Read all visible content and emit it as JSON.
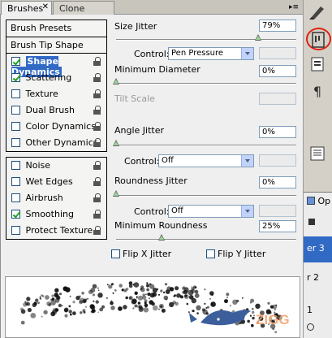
{
  "tabs": [
    {
      "label": "Brushes",
      "close": "✕"
    },
    {
      "label": "Clone Source"
    }
  ],
  "menu_icon": "▸≡",
  "options": {
    "presets": "Brush Presets",
    "tip_shape": "Brush Tip Shape",
    "group1": [
      {
        "label": "Shape Dynamics",
        "checked": true,
        "selected": true
      },
      {
        "label": "Scattering",
        "checked": true
      },
      {
        "label": "Texture",
        "checked": false
      },
      {
        "label": "Dual Brush",
        "checked": false
      },
      {
        "label": "Color Dynamics",
        "checked": false
      },
      {
        "label": "Other Dynamics",
        "checked": false
      }
    ],
    "group2": [
      {
        "label": "Noise",
        "checked": false
      },
      {
        "label": "Wet Edges",
        "checked": false
      },
      {
        "label": "Airbrush",
        "checked": false
      },
      {
        "label": "Smoothing",
        "checked": true
      },
      {
        "label": "Protect Texture",
        "checked": false
      }
    ]
  },
  "controls": {
    "size_jitter": {
      "label": "Size Jitter",
      "value": "79%",
      "level": 0.79
    },
    "control1": {
      "label": "Control:",
      "value": "Pen Pressure"
    },
    "min_diameter": {
      "label": "Minimum Diameter",
      "value": "0%",
      "level": 0
    },
    "tilt_scale": {
      "label": "Tilt Scale"
    },
    "angle_jitter": {
      "label": "Angle Jitter",
      "value": "0%",
      "level": 0
    },
    "control2": {
      "label": "Control:",
      "value": "Off"
    },
    "roundness_jitter": {
      "label": "Roundness Jitter",
      "value": "0%",
      "level": 0
    },
    "control3": {
      "label": "Control:",
      "value": "Off"
    },
    "min_roundness": {
      "label": "Minimum Roundness",
      "value": "25%",
      "level": 0.25
    },
    "flip_x": {
      "label": "Flip X Jitter",
      "checked": false
    },
    "flip_y": {
      "label": "Flip Y Jitter",
      "checked": false
    }
  },
  "preview": {
    "watermark": "ZIGG"
  },
  "layers": {
    "layer_a": "er 3",
    "layer_b": "r 2",
    "layer_c": "1",
    "opacity_label": "Op"
  },
  "colors": {
    "selection": "#316ac5",
    "panel": "#efefef",
    "accent_circle": "#dd2211"
  }
}
